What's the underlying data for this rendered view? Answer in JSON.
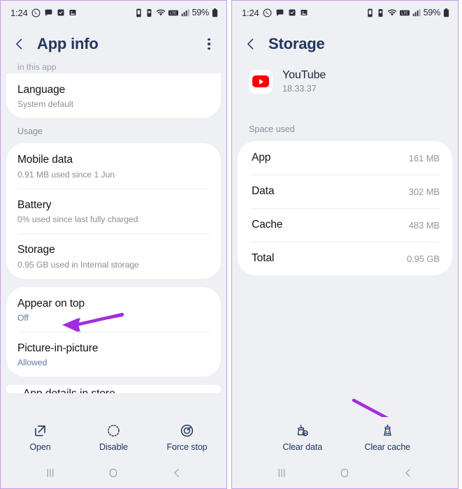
{
  "status_bar": {
    "time": "1:24",
    "battery_percent": "59%",
    "left_icons": [
      "whatsapp-icon",
      "chat-icon",
      "calendar-icon",
      "gallery-icon"
    ],
    "right_icons": [
      "alarm-icon",
      "vibrate-icon",
      "wifi-icon",
      "volte-icon",
      "signal-icon",
      "battery-icon"
    ]
  },
  "left_screen": {
    "title": "App info",
    "menu_icon": "overflow-menu-icon",
    "back_icon": "back-chevron-icon",
    "clipped_top_text": "in this app",
    "rows": [
      {
        "title": "Language",
        "subtitle": "System default",
        "sub_style": "gray"
      }
    ],
    "usage_label": "Usage",
    "usage_rows": [
      {
        "title": "Mobile data",
        "subtitle": "0.91 MB used since 1 Jun",
        "sub_style": "gray"
      },
      {
        "title": "Battery",
        "subtitle": "0% used since last fully charged",
        "sub_style": "gray"
      },
      {
        "title": "Storage",
        "subtitle": "0.95 GB used in Internal storage",
        "sub_style": "gray"
      }
    ],
    "permission_rows": [
      {
        "title": "Appear on top",
        "subtitle": "Off",
        "sub_style": "blue"
      },
      {
        "title": "Picture-in-picture",
        "subtitle": "Allowed",
        "sub_style": "blue"
      }
    ],
    "clipped_bottom_text": "App details in store",
    "actions": [
      {
        "label": "Open",
        "icon": "open-external-icon"
      },
      {
        "label": "Disable",
        "icon": "disable-dashed-circle-icon"
      },
      {
        "label": "Force stop",
        "icon": "force-stop-icon"
      }
    ],
    "annotation": {
      "type": "arrow",
      "points_to": "Storage",
      "color": "#a32ce0"
    }
  },
  "right_screen": {
    "title": "Storage",
    "back_icon": "back-chevron-icon",
    "app": {
      "name": "YouTube",
      "version": "18.33.37",
      "icon": "youtube-icon",
      "icon_color": "#ff0000"
    },
    "space_used_label": "Space used",
    "space_rows": [
      {
        "key": "App",
        "value": "161 MB"
      },
      {
        "key": "Data",
        "value": "302 MB"
      },
      {
        "key": "Cache",
        "value": "483 MB"
      },
      {
        "key": "Total",
        "value": "0.95 GB"
      }
    ],
    "actions": [
      {
        "label": "Clear data",
        "icon": "clear-data-broom-icon"
      },
      {
        "label": "Clear cache",
        "icon": "clear-cache-broom-icon"
      }
    ],
    "annotation": {
      "type": "arrow",
      "points_to": "Clear cache",
      "color": "#a32ce0"
    }
  },
  "nav_bar": {
    "recents": "recents-icon",
    "home": "home-icon",
    "back": "back-icon"
  },
  "colors": {
    "background": "#eef0f4",
    "card": "#ffffff",
    "title": "#22365f",
    "accent_arrow": "#a32ce0",
    "frame_border": "#c79af0"
  }
}
